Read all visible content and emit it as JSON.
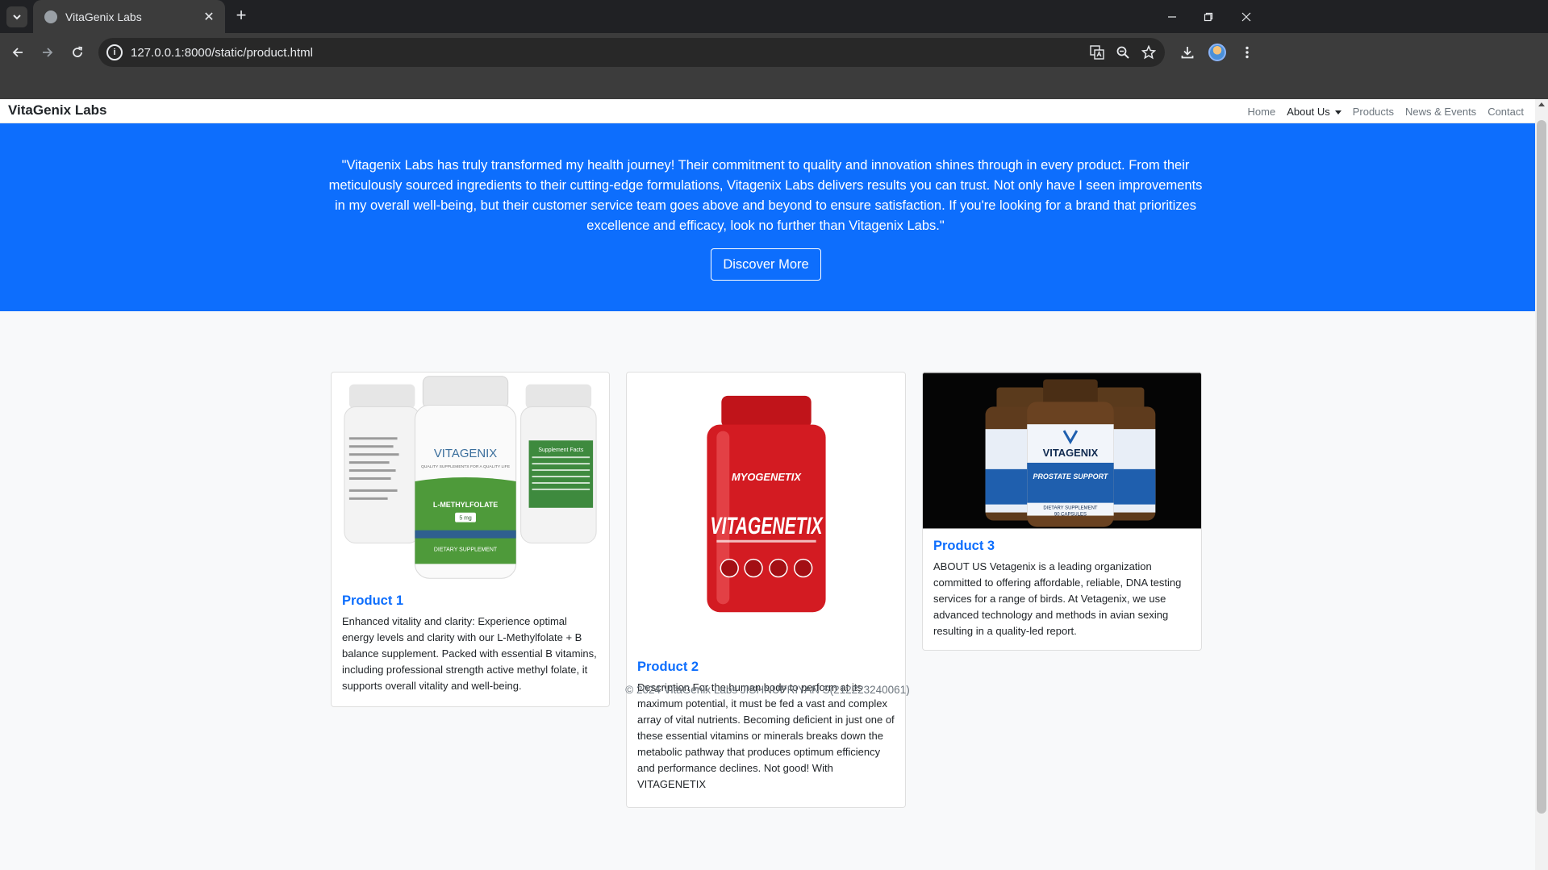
{
  "browser": {
    "tab_title": "VitaGenix Labs",
    "url": "127.0.0.1:8000/static/product.html"
  },
  "site": {
    "brand": "VitaGenix Labs",
    "nav": {
      "home": "Home",
      "about": "About Us",
      "products": "Products",
      "news": "News & Events",
      "contact": "Contact"
    }
  },
  "hero": {
    "quote": "\"Vitagenix Labs has truly transformed my health journey! Their commitment to quality and innovation shines through in every product. From their meticulously sourced ingredients to their cutting-edge formulations, Vitagenix Labs delivers results you can trust. Not only have I seen improvements in my overall well-being, but their customer service team goes above and beyond to ensure satisfaction. If you're looking for a brand that prioritizes excellence and efficacy, look no further than Vitagenix Labs.\"",
    "button": "Discover More"
  },
  "products": [
    {
      "title": "Product 1",
      "description": "Enhanced vitality and clarity: Experience optimal energy levels and clarity with our L-Methylfolate + B balance supplement. Packed with essential B vitamins, including professional strength active methyl folate, it supports overall vitality and well-being.",
      "label_brand": "VITAGENIX",
      "label_tagline": "QUALITY SUPPLEMENTS FOR A QUALITY LIFE",
      "label_name": "L-METHYLFOLATE",
      "label_dose": "5 mg",
      "label_type": "DIETARY SUPPLEMENT",
      "label_facts": "Supplement Facts"
    },
    {
      "title": "Product 2",
      "description": "Description For the human body to perform at its maximum potential, it must be fed a vast and complex array of vital nutrients. Becoming deficient in just one of these essential vitamins or minerals breaks down the metabolic pathway that produces optimum efficiency and performance declines. Not good! With VITAGENETIX",
      "label_top": "MYOGENETIX",
      "label_brand": "VITAGENETIX"
    },
    {
      "title": "Product 3",
      "description": "ABOUT US Vetagenix is a leading organization committed to offering affordable, reliable, DNA testing services for a range of birds. At Vetagenix, we use advanced technology and methods in avian sexing resulting in a quality-led report.",
      "label_brand": "VITAGENIX",
      "label_name": "PROSTATE SUPPORT",
      "label_type": "DIETARY SUPPLEMENT",
      "label_count": "90 CAPSULES"
    }
  ],
  "footer": "© 2024 VitaGenix Labs JISHNUPRIYAN S(212223240061)"
}
